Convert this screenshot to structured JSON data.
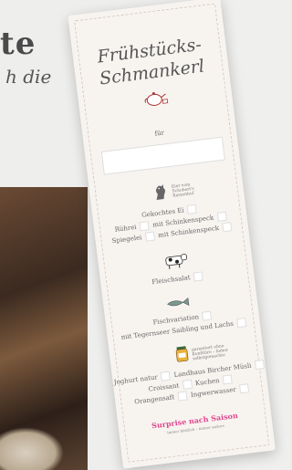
{
  "page": {
    "heading_partial": "te",
    "subtext_partial": "h die"
  },
  "card": {
    "title_line1": "Frühstücks-",
    "title_line2": "Schmankerl",
    "name_label": "für",
    "egg_note": "Eier vom Schobert's Ratzenhof",
    "egg_heading": "Gekochtes Ei",
    "egg_row1_a": "Rührei",
    "egg_row1_b": "mit Schinkenspeck",
    "egg_row2_a": "Spiegelei",
    "egg_row2_b": "mit Schinkenspeck",
    "meat_label": "Fleischsalat",
    "fish_label": "Fischvariation",
    "fish_detail": "mit Tegernseer Saibling und Lachs",
    "jar_note": "garantiert ohne Konfitüre – lieber selbstgemachte",
    "row1_a": "Joghurt natur",
    "row1_b": "Landhaus Bircher Müsli",
    "row2_a": "Croissant",
    "row2_b": "Kuchen",
    "row3_a": "Orangensaft",
    "row3_b": "Ingwerwasser",
    "surprise": "Surprise nach Saison",
    "surprise_note": "immer köstlich – immer anders"
  },
  "colors": {
    "accent_pink": "#e0488f",
    "card_bg": "#f7f4f0",
    "border_pink": "#d8c9c0"
  },
  "icons": [
    "teapot-icon",
    "rooster-icon",
    "cow-icon",
    "fish-icon",
    "jam-jar-icon"
  ]
}
